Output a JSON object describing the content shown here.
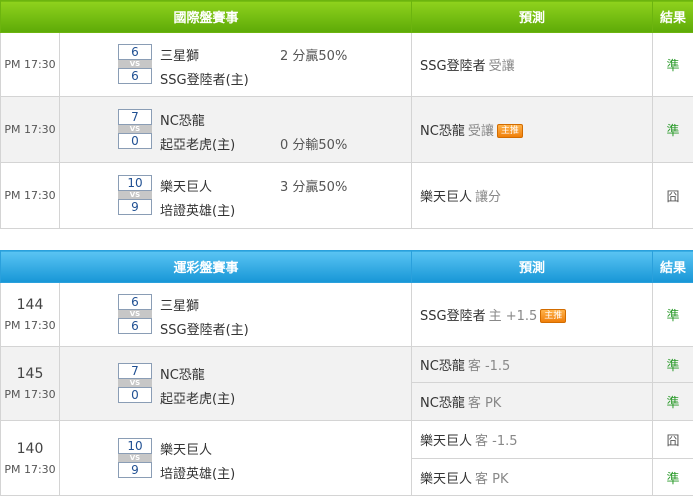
{
  "intl": {
    "header": {
      "event": "國際盤賽事",
      "prediction": "預測",
      "result": "結果"
    },
    "rows": [
      {
        "time": "PM 17:30",
        "score_a": "6",
        "score_b": "6",
        "vs": "VS",
        "team_a": "三星獅",
        "team_b": "SSG登陸者(主)",
        "handicap": "2 分贏50%",
        "handicap_pos": "a",
        "pick": "SSG登陸者",
        "pick_sub": "受讓",
        "badge": "",
        "result": "準"
      },
      {
        "time": "PM 17:30",
        "score_a": "7",
        "score_b": "0",
        "vs": "VS",
        "team_a": "NC恐龍",
        "team_b": "起亞老虎(主)",
        "handicap": "0 分輸50%",
        "handicap_pos": "b",
        "pick": "NC恐龍",
        "pick_sub": "受讓",
        "badge": "主推",
        "result": "準"
      },
      {
        "time": "PM 17:30",
        "score_a": "10",
        "score_b": "9",
        "vs": "VS",
        "team_a": "樂天巨人",
        "team_b": "培證英雄(主)",
        "handicap": "3 分贏50%",
        "handicap_pos": "a",
        "pick": "樂天巨人",
        "pick_sub": "讓分",
        "badge": "",
        "result": "囧"
      }
    ]
  },
  "lottery": {
    "header": {
      "event": "運彩盤賽事",
      "prediction": "預測",
      "result": "結果"
    },
    "rows": [
      {
        "num": "144",
        "time": "PM 17:30",
        "score_a": "6",
        "score_b": "6",
        "vs": "VS",
        "team_a": "三星獅",
        "team_b": "SSG登陸者(主)",
        "picks": [
          {
            "team": "SSG登陸者",
            "sub": "主 +1.5",
            "badge": "主推",
            "result": "準"
          }
        ]
      },
      {
        "num": "145",
        "time": "PM 17:30",
        "score_a": "7",
        "score_b": "0",
        "vs": "VS",
        "team_a": "NC恐龍",
        "team_b": "起亞老虎(主)",
        "picks": [
          {
            "team": "NC恐龍",
            "sub": "客 -1.5",
            "badge": "",
            "result": "準"
          },
          {
            "team": "NC恐龍",
            "sub": "客 PK",
            "badge": "",
            "result": "準"
          }
        ]
      },
      {
        "num": "140",
        "time": "PM 17:30",
        "score_a": "10",
        "score_b": "9",
        "vs": "VS",
        "team_a": "樂天巨人",
        "team_b": "培證英雄(主)",
        "picks": [
          {
            "team": "樂天巨人",
            "sub": "客 -1.5",
            "badge": "",
            "result": "囧"
          },
          {
            "team": "樂天巨人",
            "sub": "客 PK",
            "badge": "",
            "result": "準"
          }
        ]
      }
    ]
  },
  "colors": {
    "intl_header": "#6cb40f",
    "lottery_header": "#1796d6",
    "win": "#2a9a2a",
    "badge": "#f07f0a"
  }
}
